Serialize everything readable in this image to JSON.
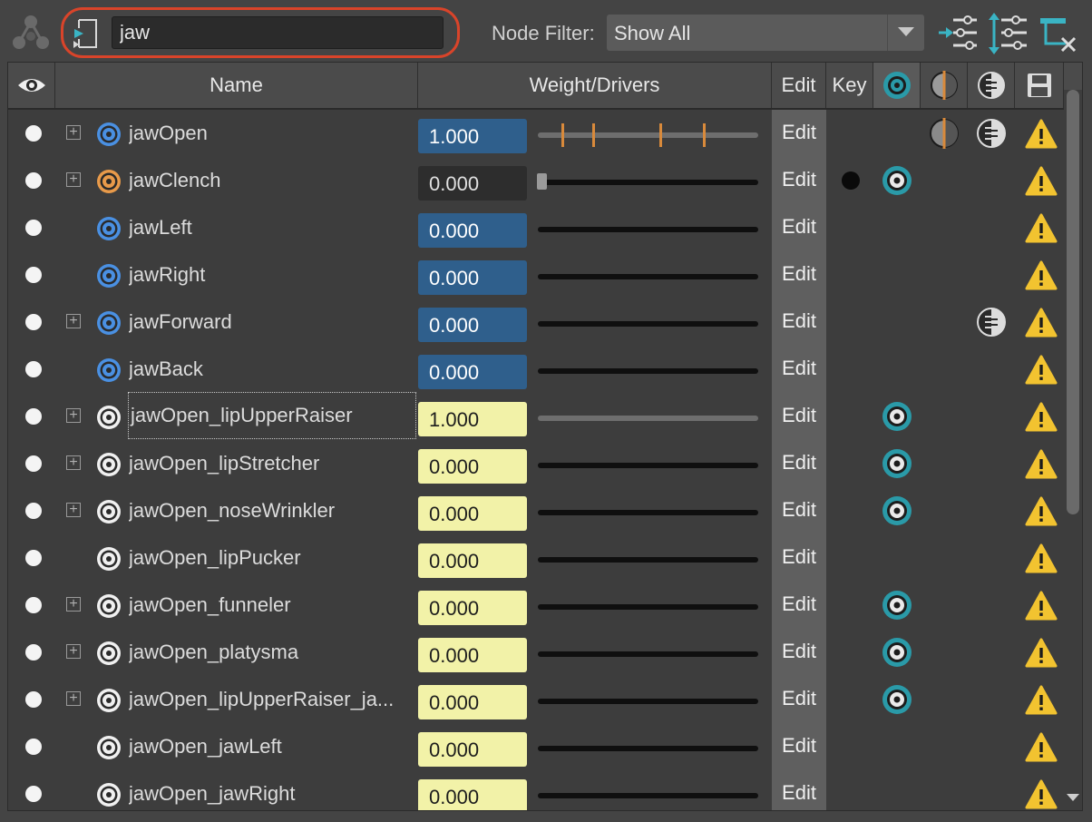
{
  "search": {
    "value": "jaw"
  },
  "node_filter": {
    "label": "Node Filter:",
    "selected": "Show All"
  },
  "columns": {
    "name": "Name",
    "weight": "Weight/Drivers",
    "edit": "Edit",
    "key": "Key"
  },
  "rows": [
    {
      "name": "jawOpen",
      "weight": "1.000",
      "edit": "Edit"
    },
    {
      "name": "jawClench",
      "weight": "0.000",
      "edit": "Edit"
    },
    {
      "name": "jawLeft",
      "weight": "0.000",
      "edit": "Edit"
    },
    {
      "name": "jawRight",
      "weight": "0.000",
      "edit": "Edit"
    },
    {
      "name": "jawForward",
      "weight": "0.000",
      "edit": "Edit"
    },
    {
      "name": "jawBack",
      "weight": "0.000",
      "edit": "Edit"
    },
    {
      "name": "jawOpen_lipUpperRaiser",
      "weight": "1.000",
      "edit": "Edit"
    },
    {
      "name": "jawOpen_lipStretcher",
      "weight": "0.000",
      "edit": "Edit"
    },
    {
      "name": "jawOpen_noseWrinkler",
      "weight": "0.000",
      "edit": "Edit"
    },
    {
      "name": "jawOpen_lipPucker",
      "weight": "0.000",
      "edit": "Edit"
    },
    {
      "name": "jawOpen_funneler",
      "weight": "0.000",
      "edit": "Edit"
    },
    {
      "name": "jawOpen_platysma",
      "weight": "0.000",
      "edit": "Edit"
    },
    {
      "name": "jawOpen_lipUpperRaiser_ja...",
      "weight": "0.000",
      "edit": "Edit"
    },
    {
      "name": "jawOpen_jawLeft",
      "weight": "0.000",
      "edit": "Edit"
    },
    {
      "name": "jawOpen_jawRight",
      "weight": "0.000",
      "edit": "Edit"
    }
  ],
  "colors": {
    "accent_red": "#d9442a",
    "weight_blue": "#2f5f8c",
    "weight_yellow": "#f2f2a8",
    "driver_tick": "#d98a3b",
    "teal_icon": "#2a9aa8",
    "warning": "#f2c330"
  }
}
